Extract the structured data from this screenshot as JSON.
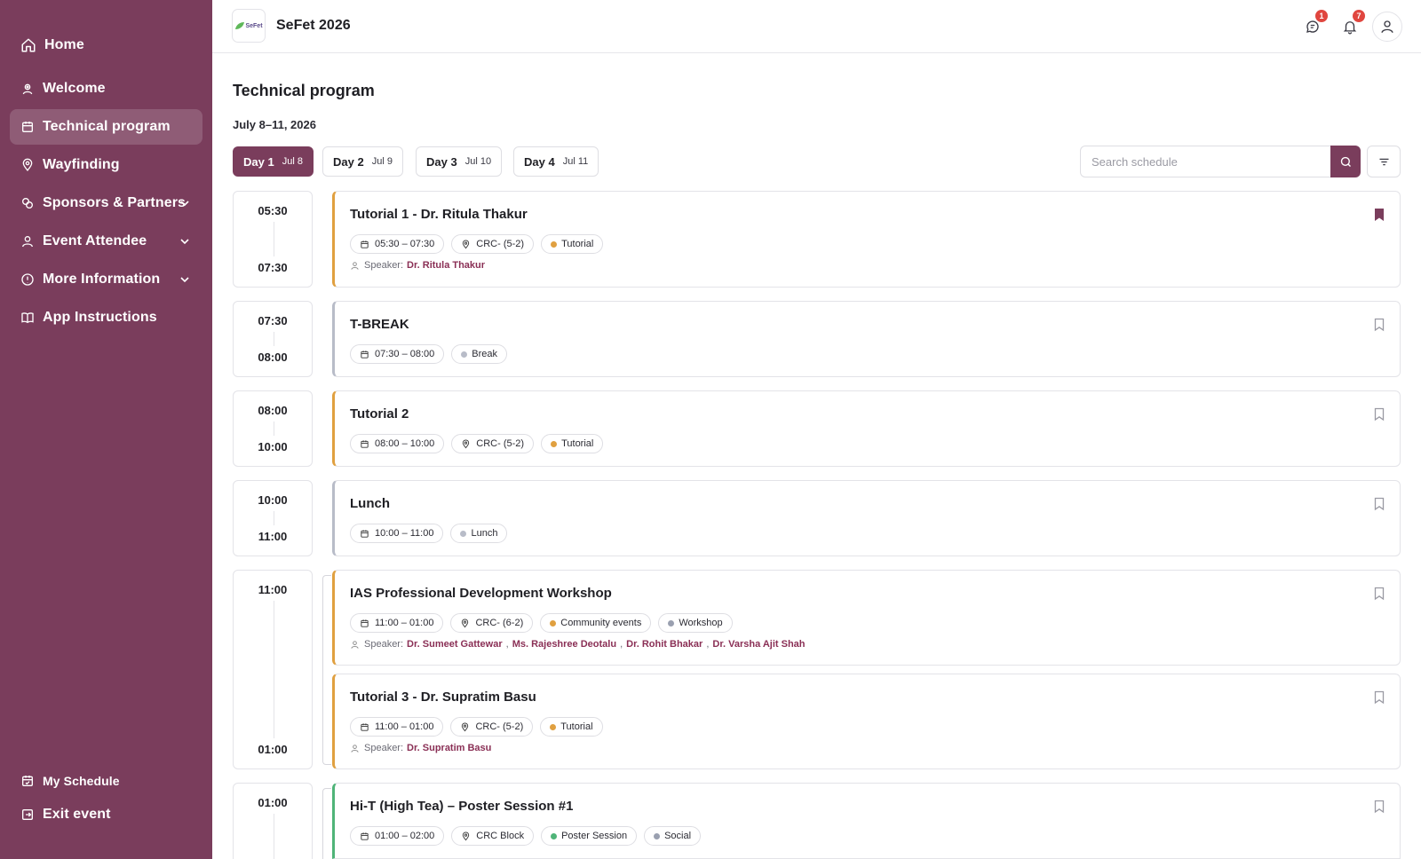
{
  "colors": {
    "brand": "#7a3d5c",
    "tutorial": "#e0a040",
    "break": "#b8bcc8",
    "poster": "#4fb478",
    "badge": "#e0463f"
  },
  "sidebar": {
    "items": [
      {
        "label": "Home",
        "icon": "home-icon"
      },
      {
        "label": "Welcome",
        "icon": "welcome-icon"
      },
      {
        "label": "Technical program",
        "icon": "calendar-icon",
        "active": true
      },
      {
        "label": "Wayfinding",
        "icon": "map-pin-icon"
      },
      {
        "label": "Sponsors & Partners",
        "icon": "sponsors-icon",
        "has_submenu": true
      },
      {
        "label": "Event Attendee",
        "icon": "user-icon",
        "has_submenu": true
      },
      {
        "label": "More Information",
        "icon": "info-icon",
        "has_submenu": true
      },
      {
        "label": "App Instructions",
        "icon": "book-icon"
      }
    ],
    "bottom": [
      {
        "label": "My Schedule",
        "icon": "calendar-check-icon"
      },
      {
        "label": "Exit event",
        "icon": "exit-icon"
      }
    ]
  },
  "topbar": {
    "logo_text": "SeFet",
    "title": "SeFet 2026",
    "messages_badge": "1",
    "notifications_badge": "7"
  },
  "page": {
    "title": "Technical program",
    "dates": "July 8–11, 2026"
  },
  "days": [
    {
      "label": "Day 1",
      "date": "Jul 8",
      "active": true
    },
    {
      "label": "Day 2",
      "date": "Jul 9"
    },
    {
      "label": "Day 3",
      "date": "Jul 10"
    },
    {
      "label": "Day 4",
      "date": "Jul 11"
    }
  ],
  "search": {
    "placeholder": "Search schedule"
  },
  "slots": [
    {
      "start": "05:30",
      "end": "07:30"
    },
    {
      "start": "07:30",
      "end": "08:00"
    },
    {
      "start": "08:00",
      "end": "10:00"
    },
    {
      "start": "10:00",
      "end": "11:00"
    },
    {
      "start": "11:00",
      "end": "01:00"
    },
    {
      "start": "01:00",
      "end": ""
    }
  ],
  "events": [
    {
      "title": "Tutorial 1 - Dr. Ritula Thakur",
      "time": "05:30 – 07:30",
      "location": "CRC- (5-2)",
      "tags": [
        "Tutorial"
      ],
      "speaker_label": "Speaker:",
      "speakers": [
        "Dr. Ritula Thakur"
      ],
      "bookmarked": true
    },
    {
      "title": "T-BREAK",
      "time": "07:30 – 08:00",
      "tags": [
        "Break"
      ]
    },
    {
      "title": "Tutorial 2",
      "time": "08:00 – 10:00",
      "location": "CRC- (5-2)",
      "tags": [
        "Tutorial"
      ]
    },
    {
      "title": "Lunch",
      "time": "10:00 – 11:00",
      "tags": [
        "Lunch"
      ]
    },
    {
      "title": "IAS Professional Development Workshop",
      "time": "11:00 – 01:00",
      "location": "CRC- (6-2)",
      "tags": [
        "Community events",
        "Workshop"
      ],
      "speaker_label": "Speaker:",
      "speakers": [
        "Dr. Sumeet Gattewar",
        "Ms. Rajeshree Deotalu",
        "Dr. Rohit Bhakar",
        "Dr. Varsha Ajit Shah"
      ],
      "separator": ","
    },
    {
      "title": "Tutorial 3 - Dr. Supratim Basu",
      "time": "11:00 – 01:00",
      "location": "CRC- (5-2)",
      "tags": [
        "Tutorial"
      ],
      "speaker_label": "Speaker:",
      "speakers": [
        "Dr. Supratim Basu"
      ]
    },
    {
      "title": "Hi-T (High Tea) – Poster Session #1",
      "time": "01:00 – 02:00",
      "location": "CRC Block",
      "tags": [
        "Poster Session",
        "Social"
      ]
    }
  ]
}
